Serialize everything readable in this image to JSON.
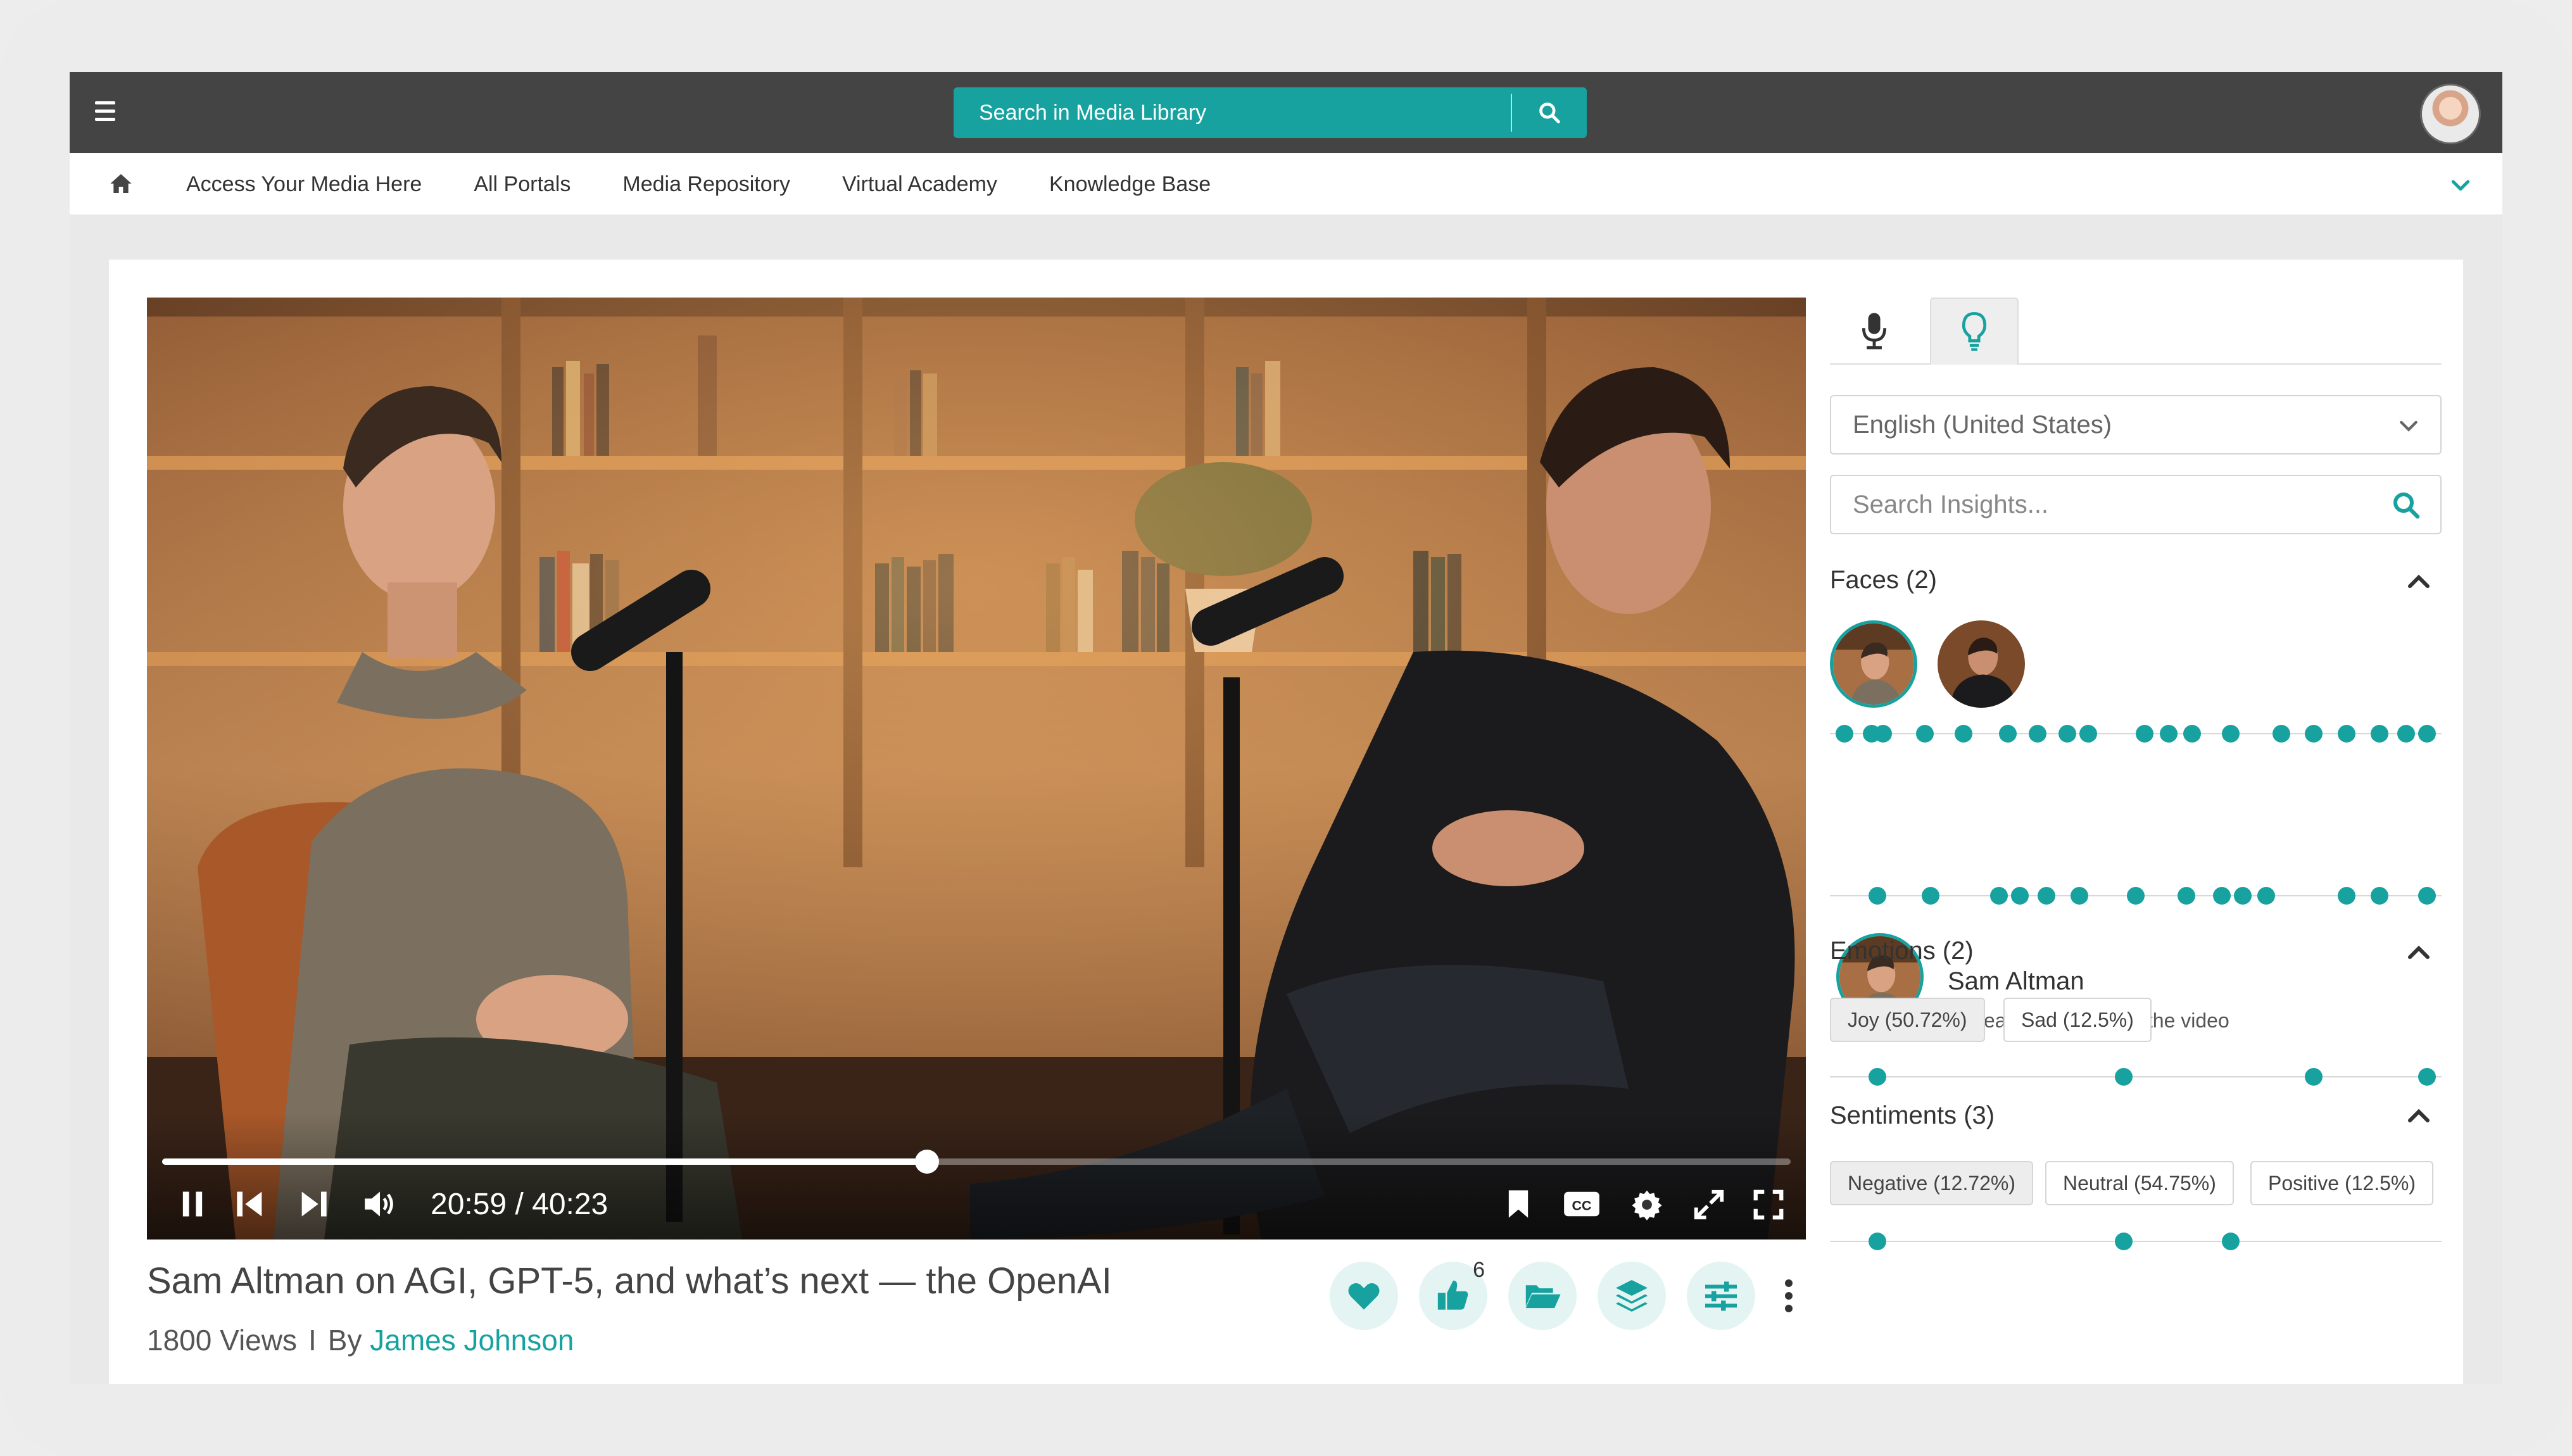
{
  "topbar": {
    "search_placeholder": "Search in Media Library"
  },
  "nav": {
    "items": [
      {
        "label": "Access Your Media Here"
      },
      {
        "label": "All Portals"
      },
      {
        "label": "Media Repository"
      },
      {
        "label": "Virtual Academy"
      },
      {
        "label": "Knowledge Base"
      }
    ]
  },
  "player": {
    "current_time": "20:59",
    "duration": "40:23",
    "time_display": "20:59 / 40:23",
    "progress": 0.4696
  },
  "video": {
    "title": "Sam Altman on AGI, GPT-5, and what’s next — the OpenAI",
    "views": "1800 Views",
    "separator": "I",
    "by_label": "By",
    "author": "James Johnson"
  },
  "actions": {
    "like_count": "6"
  },
  "insights": {
    "language": "English (United States)",
    "search_placeholder": "Search Insights...",
    "faces": {
      "title": "Faces (2)",
      "timeline": [
        0.01,
        0.055,
        0.075,
        0.145,
        0.21,
        0.285,
        0.335,
        0.385,
        0.42,
        0.515,
        0.555,
        0.595,
        0.66,
        0.745,
        0.8,
        0.855,
        0.91,
        0.955,
        0.99
      ]
    },
    "selected_person": {
      "name": "Sam Altman",
      "appears": "Appears in 53.07% of the video",
      "timeline": [
        0.065,
        0.155,
        0.27,
        0.305,
        0.35,
        0.405,
        0.5,
        0.585,
        0.645,
        0.68,
        0.72,
        0.855,
        0.91,
        0.99
      ]
    },
    "emotions": {
      "title": "Emotions (2)",
      "chips": [
        {
          "label": "Joy (50.72%)"
        },
        {
          "label": "Sad (12.5%)"
        }
      ],
      "timeline": [
        0.065,
        0.48,
        0.8,
        0.99
      ]
    },
    "sentiments": {
      "title": "Sentiments (3)",
      "chips": [
        {
          "label": "Negative (12.72%)"
        },
        {
          "label": "Neutral (54.75%)"
        },
        {
          "label": "Positive (12.5%)"
        }
      ],
      "timeline": [
        0.065,
        0.48,
        0.66
      ]
    }
  },
  "colors": {
    "accent": "#17a2a0",
    "topbar": "#444444"
  }
}
